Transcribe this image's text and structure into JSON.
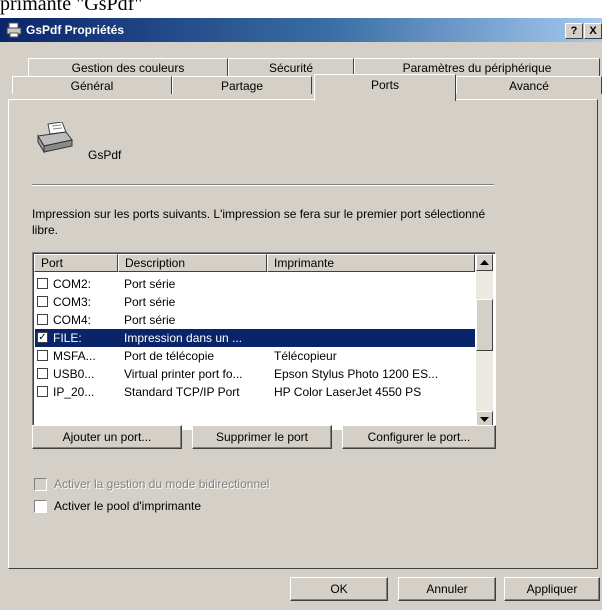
{
  "caption_fragment": "primante \"GsPdf\"",
  "window": {
    "title": "GsPdf Propriétés",
    "help_button": "?",
    "close_button": "X"
  },
  "tabs_back": [
    {
      "label": "Gestion des couleurs"
    },
    {
      "label": "Sécurité"
    },
    {
      "label": "Paramètres du périphérique"
    }
  ],
  "tabs_front": [
    {
      "label": "Général"
    },
    {
      "label": "Partage"
    },
    {
      "label": "Ports",
      "active": true
    },
    {
      "label": "Avancé"
    }
  ],
  "printer": {
    "name": "GsPdf"
  },
  "intro_text": "Impression sur les ports suivants. L'impression se fera sur le premier port sélectionné libre.",
  "ports_list": {
    "columns": [
      "Port",
      "Description",
      "Imprimante"
    ],
    "rows": [
      {
        "checked": false,
        "port": "COM2:",
        "description": "Port série",
        "printer": "",
        "selected": false
      },
      {
        "checked": false,
        "port": "COM3:",
        "description": "Port série",
        "printer": "",
        "selected": false
      },
      {
        "checked": false,
        "port": "COM4:",
        "description": "Port série",
        "printer": "",
        "selected": false
      },
      {
        "checked": true,
        "port": "FILE:",
        "description": "Impression dans un ...",
        "printer": "",
        "selected": true
      },
      {
        "checked": false,
        "port": "MSFA...",
        "description": "Port de télécopie",
        "printer": "Télécopieur",
        "selected": false
      },
      {
        "checked": false,
        "port": "USB0...",
        "description": "Virtual printer port fo...",
        "printer": "Epson Stylus Photo 1200 ES...",
        "selected": false
      },
      {
        "checked": false,
        "port": "IP_20...",
        "description": "Standard TCP/IP Port",
        "printer": "HP Color LaserJet 4550 PS",
        "selected": false
      }
    ]
  },
  "port_buttons": {
    "add": "Ajouter un port...",
    "delete": "Supprimer le port",
    "configure": "Configurer le port..."
  },
  "options": {
    "bidirectional": {
      "label": "Activer la gestion du mode bidirectionnel",
      "checked": false,
      "enabled": false
    },
    "pooling": {
      "label": "Activer le pool d'imprimante",
      "checked": false,
      "enabled": true
    }
  },
  "dialog_buttons": {
    "ok": "OK",
    "cancel": "Annuler",
    "apply": "Appliquer"
  },
  "colors": {
    "selection": "#0a246a",
    "face": "#d4d0c8",
    "title_gradient_start": "#0a246a"
  }
}
